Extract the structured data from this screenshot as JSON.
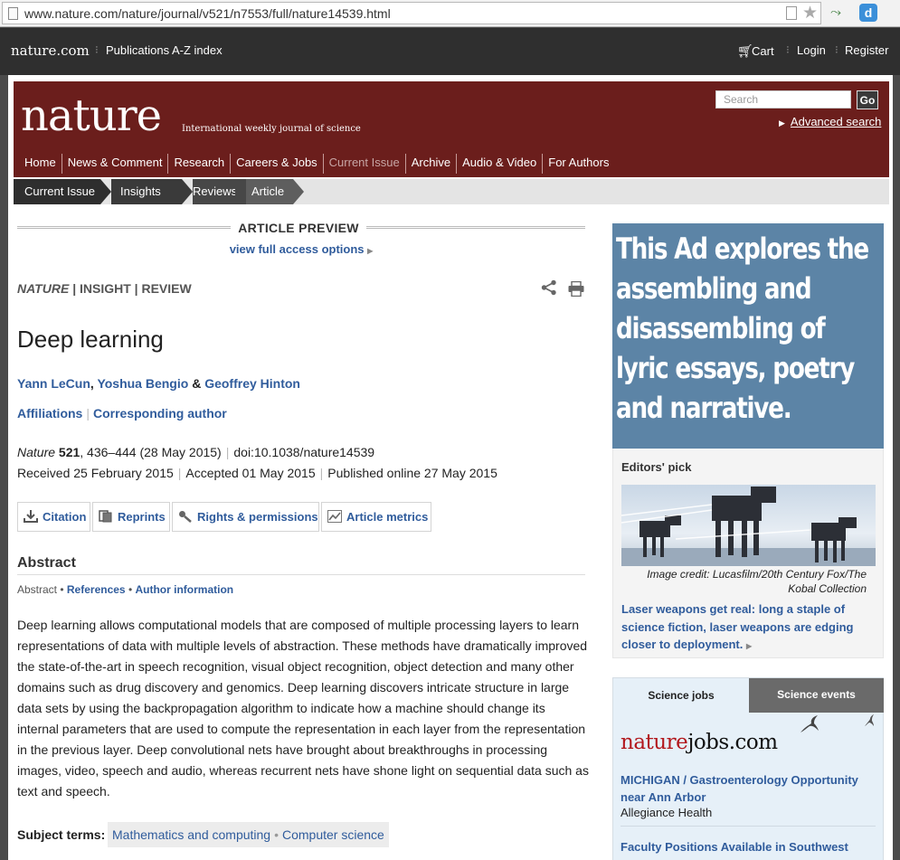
{
  "browser": {
    "url": "www.nature.com/nature/journal/v521/n7553/full/nature14539.html"
  },
  "top_bar": {
    "logo": "nature.com",
    "az_index": "Publications A-Z index",
    "cart": "Cart",
    "login": "Login",
    "register": "Register"
  },
  "masthead": {
    "logo": "nature",
    "tagline": "International weekly journal of science",
    "search_placeholder": "Search",
    "go": "Go",
    "advanced_search": "Advanced search",
    "nav": [
      {
        "label": "Home"
      },
      {
        "label": "News & Comment"
      },
      {
        "label": "Research"
      },
      {
        "label": "Careers & Jobs"
      },
      {
        "label": "Current Issue"
      },
      {
        "label": "Archive"
      },
      {
        "label": "Audio & Video"
      },
      {
        "label": "For Authors"
      }
    ]
  },
  "breadcrumb": [
    "Current Issue",
    "Insights",
    "Reviews",
    "Article"
  ],
  "article": {
    "preview_label": "ARTICLE PREVIEW",
    "full_access": "view full access options",
    "kicker_journal": "NATURE",
    "kicker_rest": "| INSIGHT | REVIEW",
    "title": "Deep learning",
    "author1": "Yann LeCun",
    "author2": "Yoshua Bengio",
    "amp": "&",
    "author3": "Geoffrey Hinton",
    "affiliations": "Affiliations",
    "corresponding": "Corresponding author",
    "cite_journal": "Nature",
    "cite_volume": "521",
    "cite_pages": ", 436–444  (28 May 2015)",
    "doi": "doi:10.1038/nature14539",
    "received": "Received  25 February 2015",
    "accepted": "Accepted  01 May 2015",
    "published": "Published online  27 May 2015",
    "tools": {
      "citation": "Citation",
      "reprints": "Reprints",
      "rights": "Rights & permissions",
      "metrics": "Article metrics"
    },
    "abstract_heading": "Abstract",
    "abs_nav_current": "Abstract",
    "abs_nav_refs": "References",
    "abs_nav_authors": "Author information",
    "abstract_text": "Deep learning allows computational models that are composed of multiple processing layers to learn representations of data with multiple levels of abstraction. These methods have dramatically improved the state-of-the-art in speech recognition, visual object recognition, object detection and many other domains such as drug discovery and genomics. Deep learning discovers intricate structure in large data sets by using the backpropagation algorithm to indicate how a machine should change its internal parameters that are used to compute the representation in each layer from the representation in the previous layer. Deep convolutional nets have brought about breakthroughs in processing images, video, speech and audio, whereas recurrent nets have shone light on sequential data such as text and speech.",
    "subject_label": "Subject terms:",
    "subject1": "Mathematics and computing",
    "subject2": "Computer science"
  },
  "sidebar": {
    "ad_text": "This Ad explores the assembling and disassembling of lyric essays, poetry and narrative.",
    "editors_heading": "Editors' pick",
    "image_credit": "Image credit: Lucasfilm/20th Century Fox/The Kobal Collection",
    "editors_text": "Laser weapons get real: long a staple of science fiction, laser weapons are edging closer to deployment.",
    "tab_jobs": "Science jobs",
    "tab_events": "Science events",
    "jobs_logo_red": "nature",
    "jobs_logo_black": "jobs.com",
    "job1_title": "MICHIGAN / Gastroenterology Opportunity near Ann Arbor",
    "job1_org": "Allegiance Health",
    "job2_title": "Faculty Positions Available in Southwest"
  },
  "colors": {
    "masthead": "#6b1e1c",
    "link": "#305c9c",
    "ad_background": "#5c84a6",
    "top_bar": "#2f2f2f"
  }
}
